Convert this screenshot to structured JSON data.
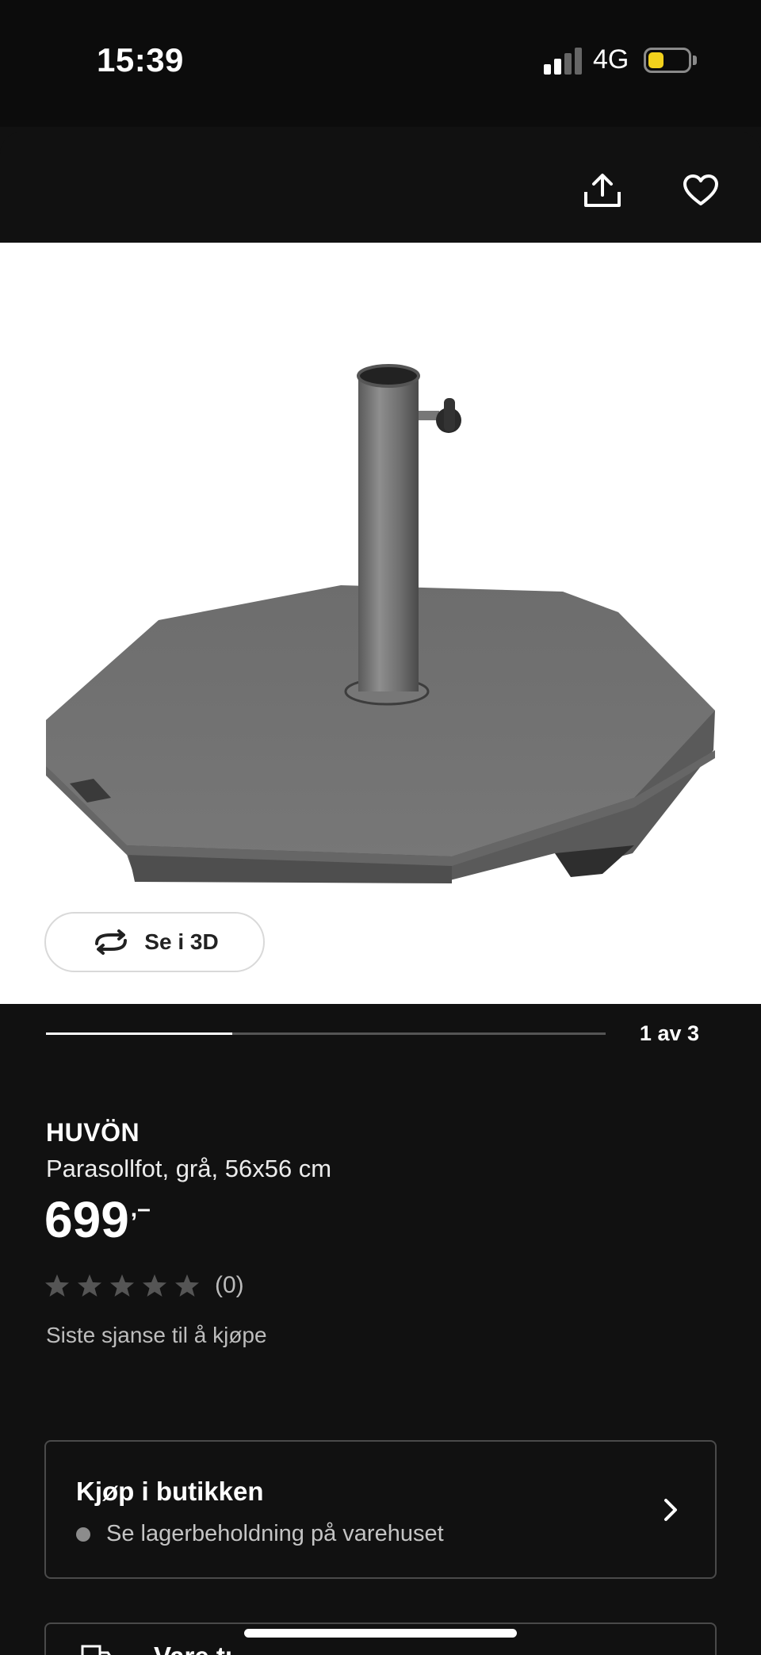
{
  "status_bar": {
    "time": "15:39",
    "network": "4G",
    "battery_level": 0.4,
    "battery_color": "#f2d11c",
    "signal_bars": 2
  },
  "header": {
    "share_icon": "share-icon",
    "favorite_icon": "heart-icon"
  },
  "gallery": {
    "view_3d_label": "Se i 3D",
    "current": 1,
    "total": 3,
    "counter": "1 av 3",
    "progress": 0.333
  },
  "product": {
    "brand": "HUVÖN",
    "description": "Parasollfot, grå, 56x56 cm",
    "price": "699",
    "price_suffix": ",–",
    "rating_stars": 0,
    "rating_max": 5,
    "rating_count": "(0)",
    "availability_note": "Siste sjanse til å kjøpe"
  },
  "store_card": {
    "title": "Kjøp i butikken",
    "subtitle": "Se lagerbeholdning på varehuset"
  },
  "delivery_card": {
    "title": "Vare tı"
  },
  "colors": {
    "background": "#111111",
    "accent_progress": "#ffffff",
    "star_empty": "#555555"
  }
}
